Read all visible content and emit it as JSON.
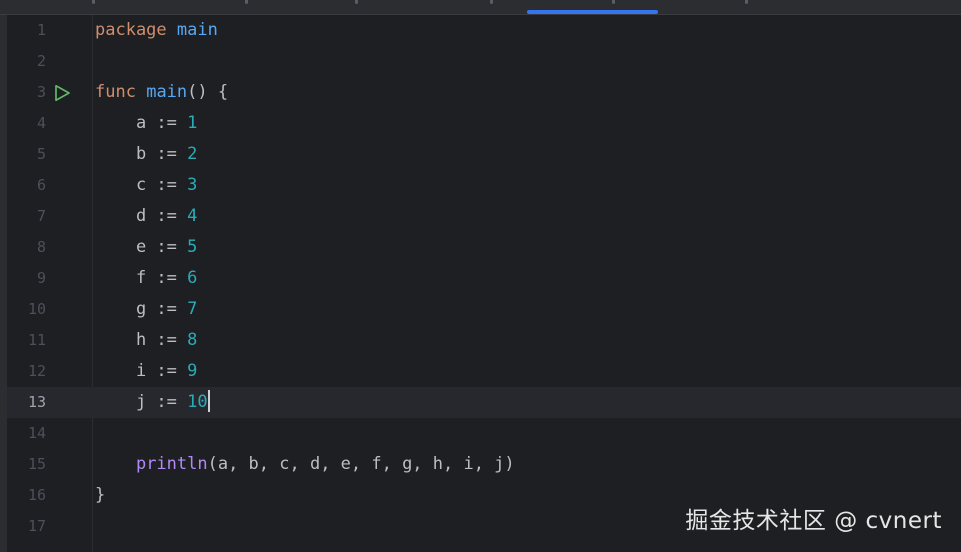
{
  "editor": {
    "lines": [
      {
        "num": "1",
        "tokens": [
          {
            "text": "package",
            "cls": "kw"
          },
          {
            "text": " ",
            "cls": ""
          },
          {
            "text": "main",
            "cls": "fn"
          }
        ]
      },
      {
        "num": "2",
        "tokens": []
      },
      {
        "num": "3",
        "run_icon": "play-icon",
        "tokens": [
          {
            "text": "func",
            "cls": "kw"
          },
          {
            "text": " ",
            "cls": ""
          },
          {
            "text": "main",
            "cls": "fn"
          },
          {
            "text": "() {",
            "cls": ""
          }
        ]
      },
      {
        "num": "4",
        "tokens": [
          {
            "text": "    a := ",
            "cls": ""
          },
          {
            "text": "1",
            "cls": "num"
          }
        ]
      },
      {
        "num": "5",
        "tokens": [
          {
            "text": "    b := ",
            "cls": ""
          },
          {
            "text": "2",
            "cls": "num"
          }
        ]
      },
      {
        "num": "6",
        "tokens": [
          {
            "text": "    c := ",
            "cls": ""
          },
          {
            "text": "3",
            "cls": "num"
          }
        ]
      },
      {
        "num": "7",
        "tokens": [
          {
            "text": "    d := ",
            "cls": ""
          },
          {
            "text": "4",
            "cls": "num"
          }
        ]
      },
      {
        "num": "8",
        "tokens": [
          {
            "text": "    e := ",
            "cls": ""
          },
          {
            "text": "5",
            "cls": "num"
          }
        ]
      },
      {
        "num": "9",
        "tokens": [
          {
            "text": "    f := ",
            "cls": ""
          },
          {
            "text": "6",
            "cls": "num"
          }
        ]
      },
      {
        "num": "10",
        "tokens": [
          {
            "text": "    g := ",
            "cls": ""
          },
          {
            "text": "7",
            "cls": "num"
          }
        ]
      },
      {
        "num": "11",
        "tokens": [
          {
            "text": "    h := ",
            "cls": ""
          },
          {
            "text": "8",
            "cls": "num"
          }
        ]
      },
      {
        "num": "12",
        "tokens": [
          {
            "text": "    i := ",
            "cls": ""
          },
          {
            "text": "9",
            "cls": "num"
          }
        ]
      },
      {
        "num": "13",
        "current": true,
        "caret": true,
        "tokens": [
          {
            "text": "    j := ",
            "cls": ""
          },
          {
            "text": "10",
            "cls": "num"
          }
        ]
      },
      {
        "num": "14",
        "tokens": []
      },
      {
        "num": "15",
        "tokens": [
          {
            "text": "    ",
            "cls": ""
          },
          {
            "text": "println",
            "cls": "call"
          },
          {
            "text": "(a, b, c, d, e, f, g, h, i, j)",
            "cls": ""
          }
        ]
      },
      {
        "num": "16",
        "tokens": [
          {
            "text": "}",
            "cls": ""
          }
        ]
      },
      {
        "num": "17",
        "tokens": []
      }
    ]
  },
  "watermark": {
    "text": "掘金技术社区 @ cvnert"
  },
  "colors": {
    "background": "#1e1f22",
    "keyword": "#cf8e6d",
    "function": "#56a8f5",
    "number": "#2aacb8",
    "builtin_call": "#b189f5",
    "text": "#bcbec4",
    "active_tab_accent": "#3574f0",
    "run_icon": "#5fb865"
  }
}
